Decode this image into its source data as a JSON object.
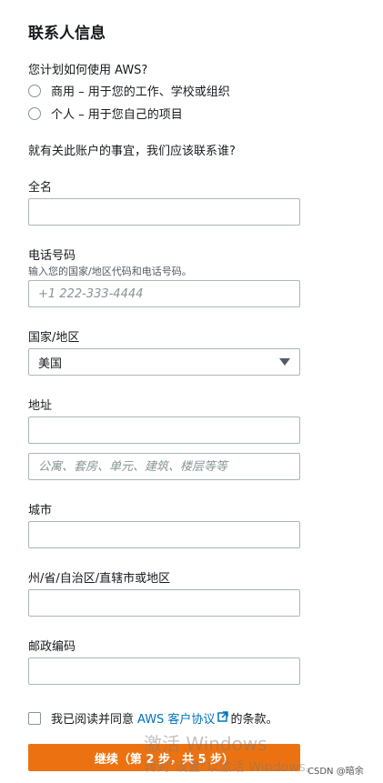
{
  "heading": "联系人信息",
  "usage": {
    "question": "您计划如何使用 AWS?",
    "options": [
      "商用 – 用于您的工作、学校或组织",
      "个人 – 用于您自己的项目"
    ]
  },
  "contact_question": "就有关此账户的事宜，我们应该联系谁?",
  "fields": {
    "full_name": {
      "label": "全名",
      "value": ""
    },
    "phone": {
      "label": "电话号码",
      "hint": "输入您的国家/地区代码和电话号码。",
      "placeholder": "+1 222-333-4444",
      "value": ""
    },
    "country": {
      "label": "国家/地区",
      "selected": "美国"
    },
    "address": {
      "label": "地址",
      "line1": "",
      "line2_placeholder": "公寓、套房、单元、建筑、楼层等等"
    },
    "city": {
      "label": "城市",
      "value": ""
    },
    "state": {
      "label": "州/省/自治区/直辖市或地区",
      "value": ""
    },
    "postal": {
      "label": "邮政编码",
      "value": ""
    }
  },
  "agreement": {
    "prefix": "我已阅读并同意",
    "link": "AWS 客户协议",
    "suffix": "的条款。"
  },
  "continue_button": "继续（第 2 步，共 5 步）",
  "overlay": {
    "watermark_line1": "激活 Windows",
    "watermark_line2": "转到\"设置\"以激活 Windows。",
    "credit": "CSDN @暗余"
  },
  "colors": {
    "accent": "#ec7211",
    "link": "#0073bb",
    "border": "#aab7b8",
    "text": "#16191f"
  }
}
